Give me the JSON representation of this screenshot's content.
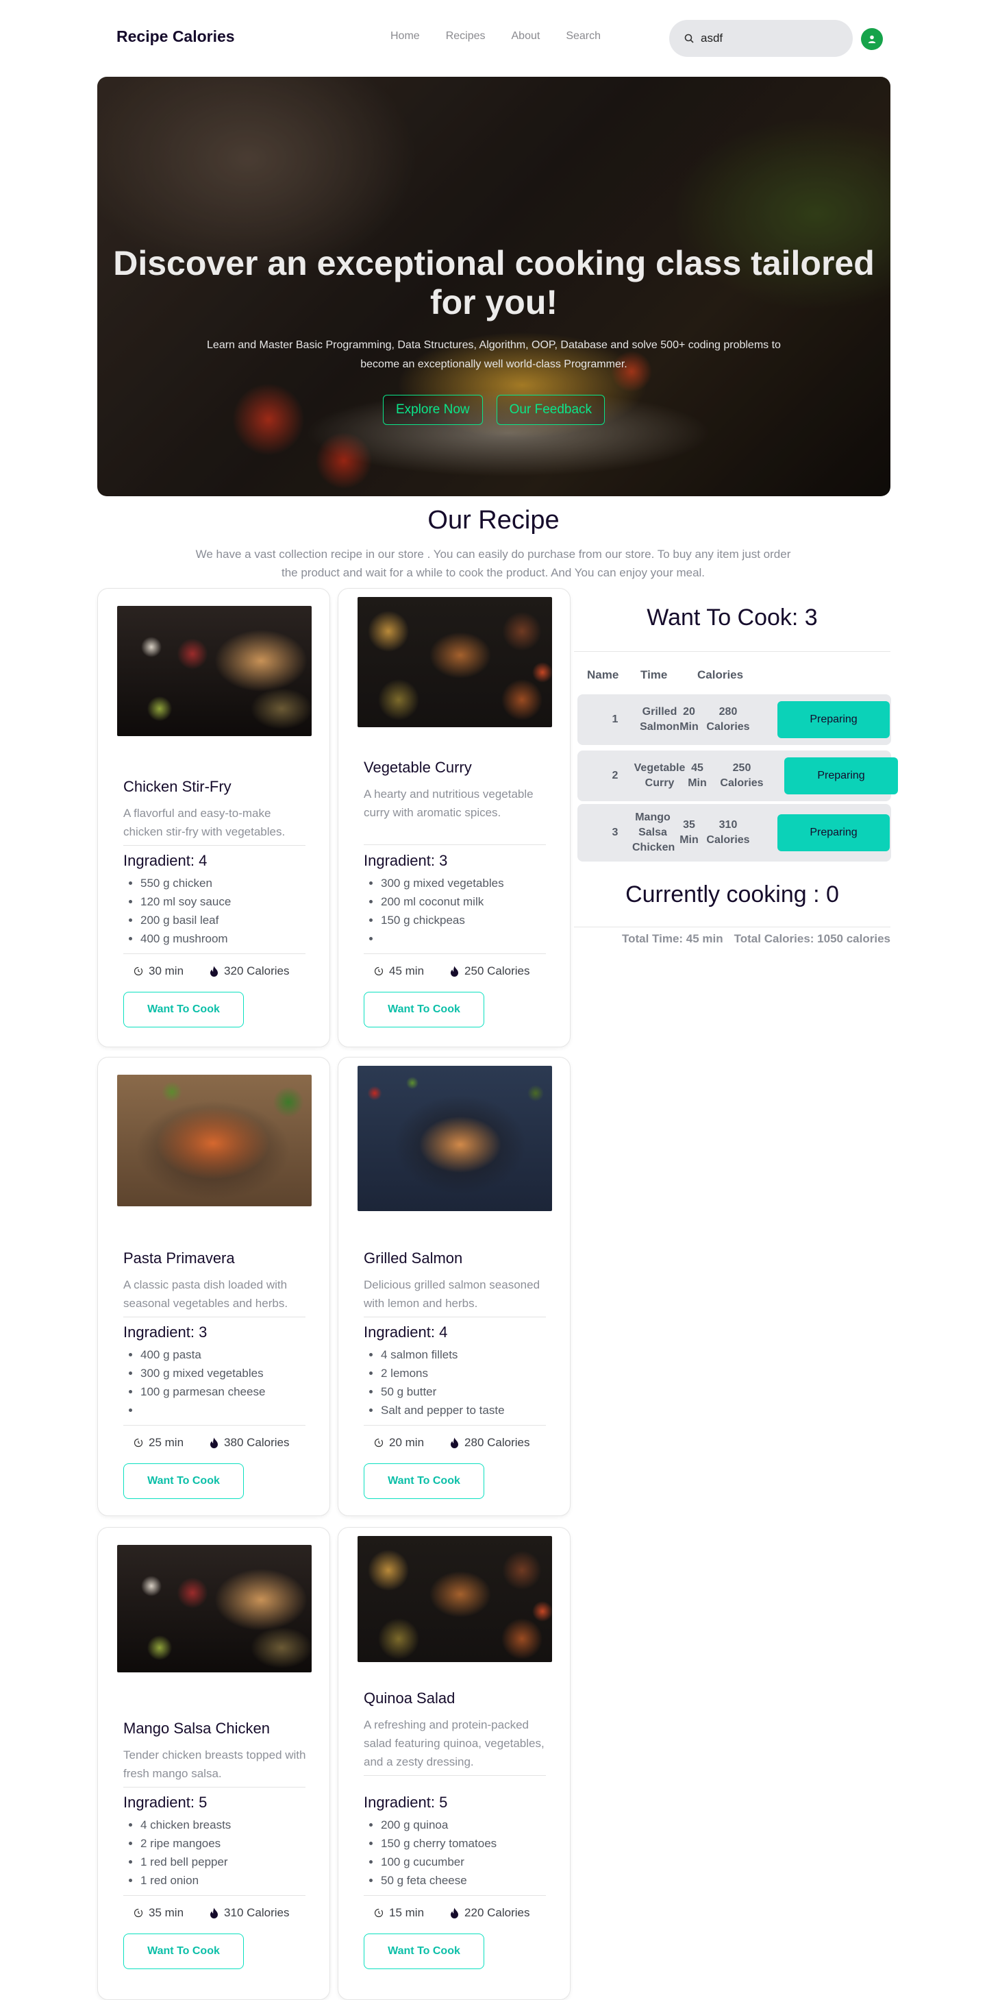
{
  "brand": "Recipe Calories",
  "menu": [
    "Home",
    "Recipes",
    "About",
    "Search"
  ],
  "search": {
    "value": "asdf",
    "icon": "search-icon"
  },
  "hero": {
    "title": "Discover an exceptional cooking class tailored for you!",
    "subtitle": "Learn and Master Basic Programming, Data Structures, Algorithm, OOP, Database and solve 500+ coding problems to become an exceptionally well world-class Programmer.",
    "buttons": [
      "Explore Now",
      "Our Feedback"
    ]
  },
  "section": {
    "title": "Our Recipe",
    "description": "We have a vast collection recipe in our store . You can easily do purchase from our store. To buy any item just order the product and wait for a while to cook the product. And You can enjoy your meal."
  },
  "recipes": [
    {
      "name": "Chicken Stir-Fry",
      "description": "A flavorful and easy-to-make chicken stir-fry with vegetables.",
      "ingredient_label": "Ingradient: 4",
      "ingredients": [
        "550 g chicken",
        "120 ml soy sauce",
        "200 g basil leaf",
        "400 g mushroom"
      ],
      "time": "30 min",
      "calories": "320 Calories",
      "button": "Want To Cook"
    },
    {
      "name": "Vegetable Curry",
      "description": "A hearty and nutritious vegetable curry with aromatic spices.",
      "ingredient_label": "Ingradient: 3",
      "ingredients": [
        "300 g mixed vegetables",
        "200 ml coconut milk",
        "150 g chickpeas",
        ""
      ],
      "time": "45 min",
      "calories": "250 Calories",
      "button": "Want To Cook"
    },
    {
      "name": "Pasta Primavera",
      "description": "A classic pasta dish loaded with seasonal vegetables and herbs.",
      "ingredient_label": "Ingradient: 3",
      "ingredients": [
        "400 g pasta",
        "300 g mixed vegetables",
        "100 g parmesan cheese",
        ""
      ],
      "time": "25 min",
      "calories": "380 Calories",
      "button": "Want To Cook"
    },
    {
      "name": "Grilled Salmon",
      "description": "Delicious grilled salmon seasoned with lemon and herbs.",
      "ingredient_label": "Ingradient: 4",
      "ingredients": [
        "4 salmon fillets",
        "2 lemons",
        "50 g butter",
        "Salt and pepper to taste"
      ],
      "time": "20 min",
      "calories": "280 Calories",
      "button": "Want To Cook"
    },
    {
      "name": "Mango Salsa Chicken",
      "description": "Tender chicken breasts topped with fresh mango salsa.",
      "ingredient_label": "Ingradient: 5",
      "ingredients": [
        "4 chicken breasts",
        "2 ripe mangoes",
        "1 red bell pepper",
        "1 red onion"
      ],
      "time": "35 min",
      "calories": "310 Calories",
      "button": "Want To Cook"
    },
    {
      "name": "Quinoa Salad",
      "description": "A refreshing and protein-packed salad featuring quinoa, vegetables, and a zesty dressing.",
      "ingredient_label": "Ingradient: 5",
      "ingredients": [
        "200 g quinoa",
        "150 g cherry tomatoes",
        "100 g cucumber",
        "50 g feta cheese"
      ],
      "time": "15 min",
      "calories": "220 Calories",
      "button": "Want To Cook"
    }
  ],
  "want_to_cook": {
    "title": "Want To Cook: 3",
    "headers": [
      "Name",
      "Time",
      "Calories"
    ],
    "rows": [
      {
        "index": "1",
        "name": "Grilled Salmon",
        "time": "20 Min",
        "calories": "280 Calories",
        "button": "Preparing"
      },
      {
        "index": "2",
        "name": "Vegetable Curry",
        "time": "45 Min",
        "calories": "250 Calories",
        "button": "Preparing"
      },
      {
        "index": "3",
        "name": "Mango Salsa Chicken",
        "time": "35 Min",
        "calories": "310 Calories",
        "button": "Preparing"
      }
    ]
  },
  "currently_cooking": {
    "title": "Currently cooking : 0",
    "total_time": "Total Time: 45 min",
    "total_calories": "Total Calories: 1050 calories"
  },
  "colors": {
    "accent": "#0BE58A",
    "teal": "#0BD2B8",
    "avatar": "#16A34A"
  }
}
